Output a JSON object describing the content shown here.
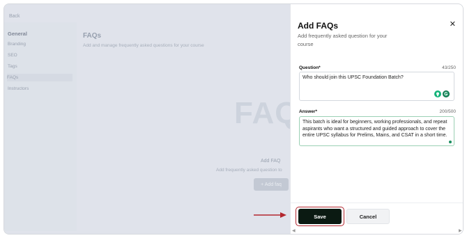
{
  "background": {
    "back_label": "Back",
    "sidebar": {
      "heading": "General",
      "items": [
        {
          "label": "Branding"
        },
        {
          "label": "SEO"
        },
        {
          "label": "Tags"
        },
        {
          "label": "FAQs"
        },
        {
          "label": "Instructors"
        }
      ]
    },
    "main": {
      "title": "FAQs",
      "subtitle": "Add and manage frequently asked questions for your course",
      "art_text": "FAQ",
      "empty_title": "Add FAQ",
      "empty_subtitle": "Add frequently asked question to",
      "add_button_label": "+ Add faq"
    }
  },
  "drawer": {
    "title": "Add FAQs",
    "close_glyph": "✕",
    "subtitle": "Add frequently asked question for your course",
    "question": {
      "label": "Question*",
      "count": "43/250",
      "value": "Who should join this UPSC Foundation Batch?"
    },
    "answer": {
      "label": "Answer*",
      "count": "200/500",
      "value": "This batch is ideal for beginners, working professionals, and repeat aspirants who want a structured and guided approach to cover the entire UPSC syllabus for Prelims, Mains, and CSAT in a short time."
    },
    "footer": {
      "save_label": "Save",
      "cancel_label": "Cancel"
    },
    "scroll_left": "◀",
    "scroll_right": "▶"
  },
  "colors": {
    "save_button": "#0b1a12",
    "highlight": "#b3262e",
    "arrow": "#b3262e",
    "grammar_icon": "#1a8e5f"
  }
}
